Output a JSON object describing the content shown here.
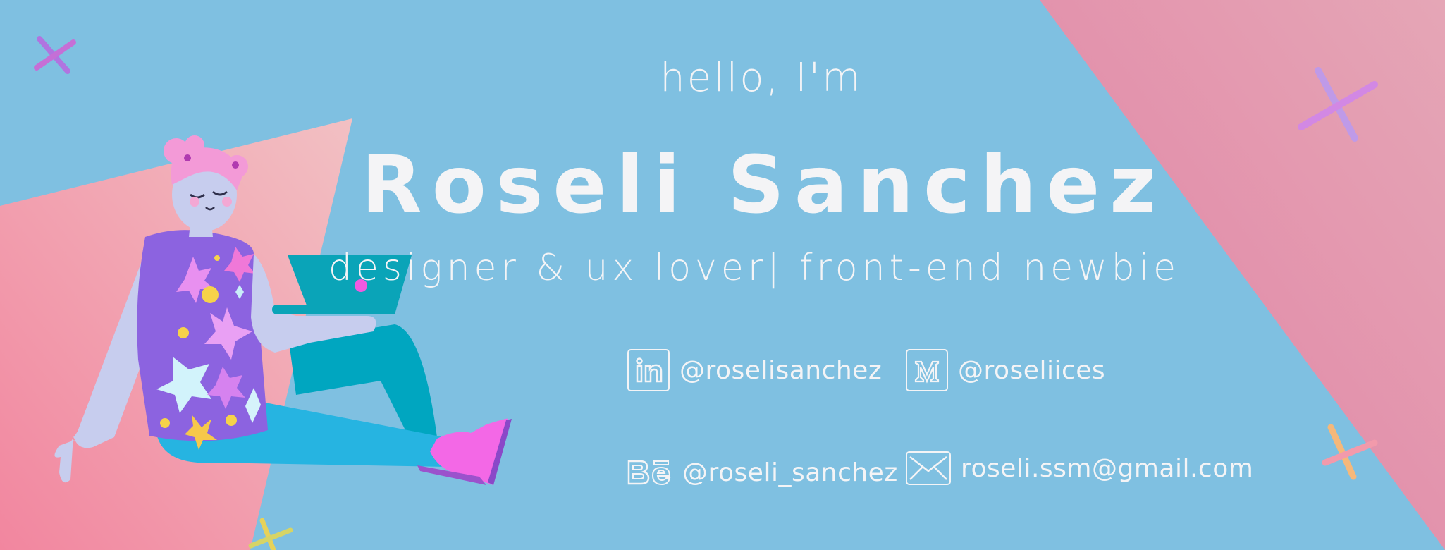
{
  "intro": {
    "greeting": "hello, I'm",
    "name": "Roseli Sanchez",
    "tagline": "designer & ux lover| front-end newbie"
  },
  "contacts": {
    "linkedin": {
      "icon": "linkedin-icon",
      "handle": "@roselisanchez"
    },
    "medium": {
      "icon": "medium-icon",
      "handle": "@roseliices"
    },
    "behance": {
      "icon": "behance-icon",
      "handle": "@roseli_sanchez"
    },
    "email": {
      "icon": "mail-icon",
      "handle": "roseli.ssm@gmail.com"
    }
  },
  "colors": {
    "background": "#7fc0e1",
    "accent_pink": "#e48aa6",
    "text": "#f4f4f6"
  }
}
